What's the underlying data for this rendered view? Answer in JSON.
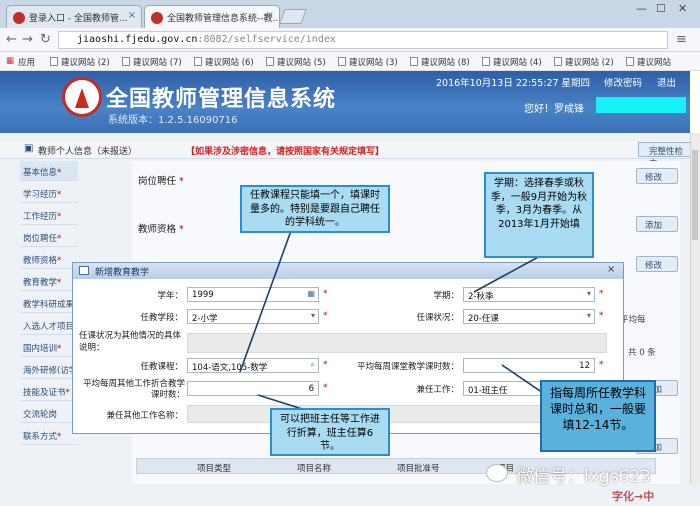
{
  "browser": {
    "tabs": [
      {
        "label": "登录入口 - 全国教师管..."
      },
      {
        "label": "全国教师管理信息系统--教..."
      }
    ],
    "url_host": "jiaoshi.fjedu.gov.cn",
    "url_path": ":8082/selfservice/index",
    "bookmarks_apps": "应用",
    "bookmarks": [
      "建议网站 (2)",
      "建议网站 (7)",
      "建议网站 (6)",
      "建议网站 (5)",
      "建议网站 (3)",
      "建议网站 (8)",
      "建议网站 (4)",
      "建议网站 (2)",
      "建议网站"
    ]
  },
  "header": {
    "title": "全国教师管理信息系统",
    "version": "系统版本：1.2.5.16090716",
    "datetime": "2016年10月13日   22:55:27   星期四",
    "change_password": "修改密码",
    "exit": "退出",
    "greeting": "您好！罗成锋"
  },
  "page": {
    "title": "教师个人信息（未报送）",
    "notice": "【如果涉及涉密信息，请按照国家有关规定填写】",
    "save_button": "完整性检查"
  },
  "sidebar": {
    "items": [
      {
        "label": "基本信息",
        "required": true
      },
      {
        "label": "学习经历",
        "required": true
      },
      {
        "label": "工作经历",
        "required": true
      },
      {
        "label": "岗位聘任",
        "required": true
      },
      {
        "label": "教师资格",
        "required": true
      },
      {
        "label": "教育教学",
        "required": true
      },
      {
        "label": "教学科研成果",
        "required": false
      },
      {
        "label": "入选人才项目",
        "required": false
      },
      {
        "label": "国内培训",
        "required": true
      },
      {
        "label": "海外研修(访学)",
        "required": false
      },
      {
        "label": "技能及证书",
        "required": true
      },
      {
        "label": "交流轮岗",
        "required": false
      },
      {
        "label": "联系方式",
        "required": true
      }
    ]
  },
  "sections": [
    {
      "label": "岗位聘任"
    },
    {
      "label": "教师资格"
    }
  ],
  "buttons": {
    "edit": "修改",
    "add": "添加"
  },
  "background_labels": {
    "col_hint": "平均每",
    "pager": "共 0 条"
  },
  "dialog": {
    "title": "新增教育教学",
    "close": "×",
    "fields": {
      "year_label": "学年：",
      "year_value": "1999",
      "term_label": "学期：",
      "term_value": "2-秋季",
      "stage_label": "任教学段：",
      "stage_value": "2-小学",
      "status_label": "任课状况：",
      "status_value": "20-任课",
      "other_label": "任课状况为其他情况的具体说明：",
      "course_label": "任教课程：",
      "course_value": "104-语文,105-数学",
      "hours_label": "平均每周课堂教学课时数：",
      "hours_value": "12",
      "other_hours_label": "平均每周其他工作折合教学课时数：",
      "other_hours_value": "6",
      "extra_label": "兼任工作：",
      "extra_value": "01-班主任",
      "extra_other_label": "兼任其他工作名称："
    }
  },
  "table": {
    "headers": [
      "项目类型",
      "项目名称",
      "项目批准号",
      "项目"
    ]
  },
  "annotations": {
    "course": "任教课程只能填一个，填课时量多的。特别是要跟自己聘任的学科统一。",
    "term": "学期：选择春季或秋季，一般9月开始为秋季，3月为春季。从2013年1月开始填",
    "hours": "指每周所任教学科课时总和，一般要填12-14节。",
    "other_hours": "可以把班主任等工作进行折算，班主任算6节。"
  },
  "watermark": "微信号：lxgs623",
  "bottom_text": "字化→中"
}
